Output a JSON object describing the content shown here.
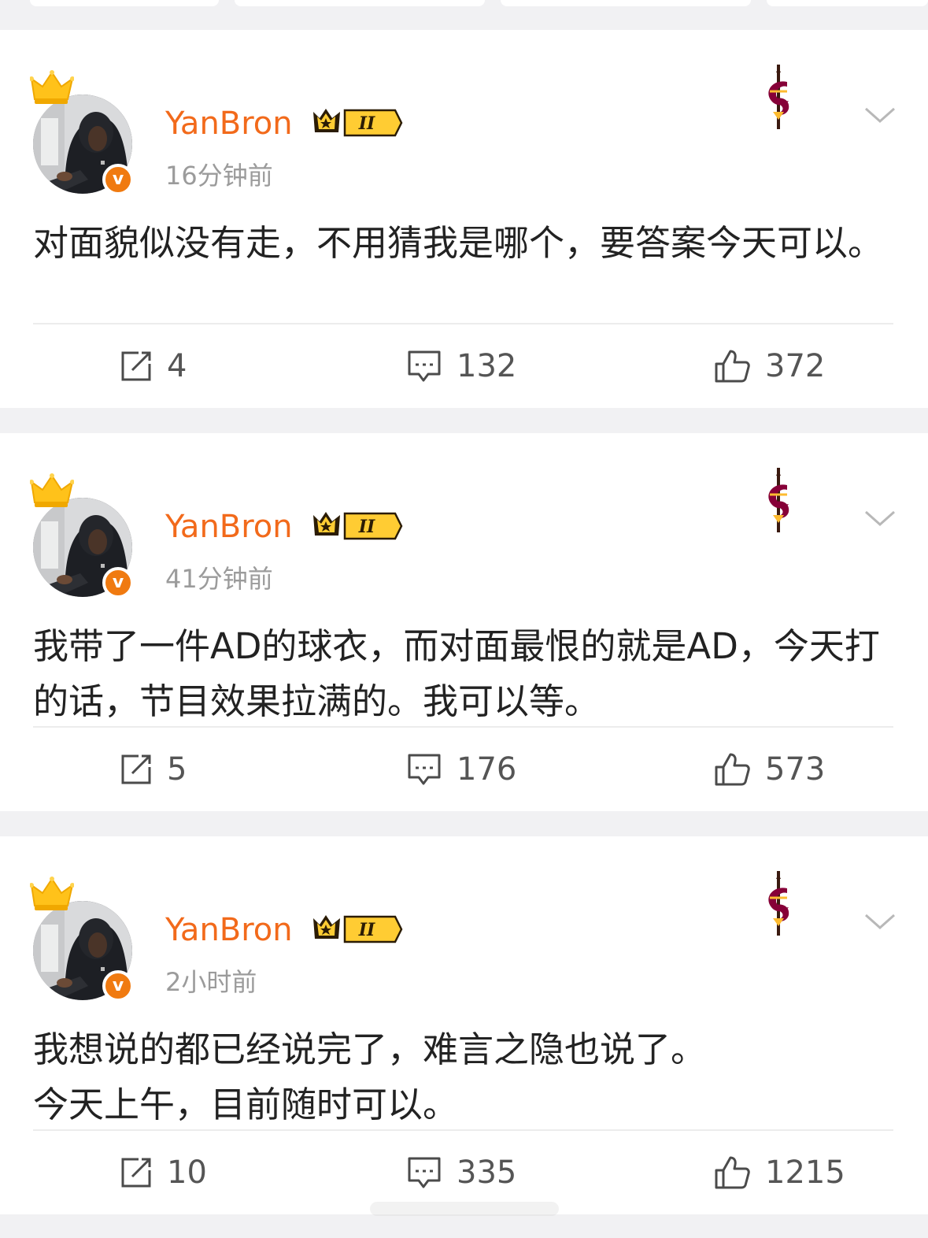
{
  "posts": [
    {
      "username": "YanBron",
      "time": "16分钟前",
      "text": "对面貌似没有走，不用猜我是哪个，要答案今天可以。",
      "reposts": "4",
      "comments": "132",
      "likes": "372"
    },
    {
      "username": "YanBron",
      "time": "41分钟前",
      "text": "我带了一件AD的球衣，而对面最恨的就是AD，今天打的话，节目效果拉满的。我可以等。",
      "reposts": "5",
      "comments": "176",
      "likes": "573"
    },
    {
      "username": "YanBron",
      "time": "2小时前",
      "text": "我想说的都已经说完了，难言之隐也说了。\n今天上午，目前随时可以。",
      "reposts": "10",
      "comments": "335",
      "likes": "1215"
    }
  ],
  "badges": {
    "verified_glyph": "v",
    "vip_level": "II"
  },
  "icons": {
    "crown": "crown-icon",
    "verified": "verified-badge-icon",
    "vip": "vip-crown-badge",
    "team_logo": "cavaliers-sword-logo",
    "more": "chevron-down-icon",
    "repost": "repost-icon",
    "comment": "comment-icon",
    "like": "thumbs-up-icon"
  },
  "colors": {
    "username": "#f26a1b",
    "timestamp": "#9b9b9b",
    "text": "#222222",
    "page_bg": "#f1f1f3",
    "card_bg": "#ffffff",
    "verified": "#f07a10",
    "team_wine": "#860038",
    "team_gold": "#fdbb30"
  }
}
